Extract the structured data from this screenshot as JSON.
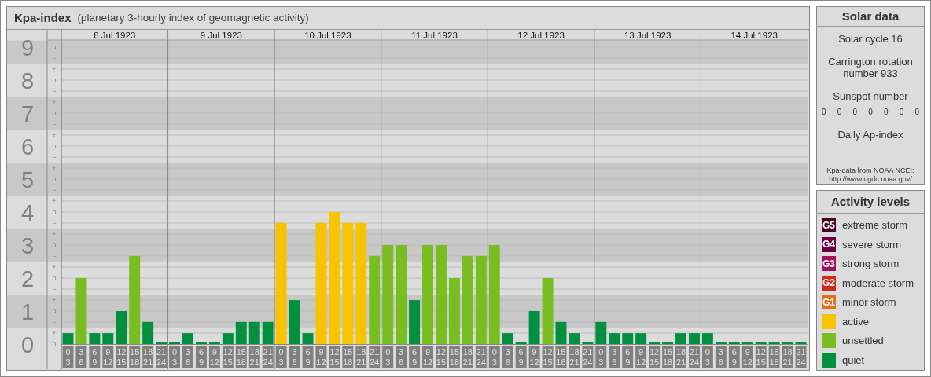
{
  "header": {
    "title": "Kpa-index",
    "subtitle": "(planetary 3-hourly index of geomagnetic activity)"
  },
  "chart": {
    "day_labels": [
      "8 Jul 1923",
      "9 Jul 1923",
      "10 Jul 1923",
      "11 Jul 1923",
      "12 Jul 1923",
      "13 Jul 1923",
      "14 Jul 1923"
    ],
    "sign_labels": [
      "o",
      "−",
      "+",
      "o",
      "−",
      "+",
      "o",
      "−",
      "+",
      "o",
      "−",
      "+",
      "o",
      "−",
      "+",
      "o",
      "−",
      "+",
      "o",
      "−",
      "+",
      "o",
      "−",
      "+",
      "o",
      "−",
      "+",
      "o"
    ],
    "chart_data": {
      "type": "bar",
      "grid": true,
      "ylim": [
        0,
        9
      ],
      "yticks": [
        0,
        1,
        2,
        3,
        4,
        5,
        6,
        7,
        8,
        9
      ],
      "bands": [
        {
          "axis": "y",
          "from": 0.5,
          "to": 1.5,
          "color": "#c8c8c8"
        },
        {
          "axis": "y",
          "from": 2.5,
          "to": 3.5,
          "color": "#c8c8c8"
        },
        {
          "axis": "y",
          "from": 4.5,
          "to": 5.5,
          "color": "#c8c8c8"
        },
        {
          "axis": "y",
          "from": 6.5,
          "to": 7.5,
          "color": "#c8c8c8"
        },
        {
          "axis": "y",
          "from": 8.5,
          "to": 9.2,
          "color": "#c8c8c8"
        }
      ],
      "categories": [
        "0 3",
        "3 6",
        "6 9",
        "9 12",
        "12 15",
        "15 18",
        "18 21",
        "21 24",
        "0 3",
        "3 6",
        "6 9",
        "9 12",
        "12 15",
        "15 18",
        "18 21",
        "21 24",
        "0 3",
        "3 6",
        "6 9",
        "9 12",
        "12 15",
        "15 18",
        "18 21",
        "21 24",
        "0 3",
        "3 6",
        "6 9",
        "9 12",
        "12 15",
        "15 18",
        "18 21",
        "21 24",
        "0 3",
        "3 6",
        "6 9",
        "9 12",
        "12 15",
        "15 18",
        "18 21",
        "21 24",
        "0 3",
        "3 6",
        "6 9",
        "9 12",
        "12 15",
        "15 18",
        "18 21",
        "21 24",
        "0 3",
        "3 6",
        "6 9",
        "9 12",
        "12 15",
        "15 18",
        "18 21",
        "21 24"
      ],
      "series": [
        {
          "name": "quiet",
          "color": "#009040",
          "values": [
            0.33,
            null,
            0.33,
            0.33,
            1,
            null,
            0.67,
            0,
            0,
            0.33,
            0,
            0,
            0.33,
            0.67,
            0.67,
            0.67,
            null,
            1.33,
            0.33,
            null,
            null,
            null,
            null,
            null,
            null,
            null,
            1.33,
            null,
            null,
            null,
            null,
            null,
            null,
            0.33,
            0,
            1,
            null,
            0.67,
            0.33,
            0,
            0.67,
            0.33,
            0.33,
            0.33,
            0,
            0,
            0.33,
            0.33,
            0.33,
            0,
            0,
            0,
            0,
            0,
            0,
            0
          ]
        },
        {
          "name": "unsettled",
          "color": "#78be20",
          "values": [
            null,
            2,
            null,
            null,
            null,
            2.67,
            null,
            null,
            null,
            null,
            null,
            null,
            null,
            null,
            null,
            null,
            null,
            null,
            null,
            null,
            null,
            null,
            null,
            2.67,
            3,
            3,
            null,
            3,
            3,
            2,
            2.67,
            2.67,
            3,
            null,
            null,
            null,
            2,
            null,
            null,
            null,
            null,
            null,
            null,
            null,
            null,
            null,
            null,
            null,
            null,
            null,
            null,
            null,
            null,
            null,
            null,
            null
          ]
        },
        {
          "name": "active",
          "color": "#f8c400",
          "values": [
            null,
            null,
            null,
            null,
            null,
            null,
            null,
            null,
            null,
            null,
            null,
            null,
            null,
            null,
            null,
            null,
            3.67,
            null,
            null,
            3.67,
            4,
            3.67,
            3.67,
            null,
            null,
            null,
            null,
            null,
            null,
            null,
            null,
            null,
            null,
            null,
            null,
            null,
            null,
            null,
            null,
            null,
            null,
            null,
            null,
            null,
            null,
            null,
            null,
            null,
            null,
            null,
            null,
            null,
            null,
            null,
            null,
            null
          ]
        }
      ]
    }
  },
  "solar_data": {
    "title": "Solar data",
    "solar_cycle": "Solar cycle 16",
    "carrington": "Carrington rotation number 933",
    "sunspot_label": "Sunspot number",
    "sunspots": [
      "0",
      "0",
      "0",
      "0",
      "0",
      "0",
      "0"
    ],
    "ap_label": "Daily Ap-index",
    "ap_values": [
      "—",
      "—",
      "—",
      "—",
      "—",
      "—",
      "—"
    ],
    "source": "Kpa-data from NOAA NCEI:",
    "source_url": "http://www.ngdc.noaa.gov/"
  },
  "activity_levels": {
    "title": "Activity levels",
    "items": [
      {
        "badge": "G5",
        "label": "extreme storm",
        "color": "#4a0020"
      },
      {
        "badge": "G4",
        "label": "severe storm",
        "color": "#6b0040"
      },
      {
        "badge": "G3",
        "label": "strong storm",
        "color": "#a5105e"
      },
      {
        "badge": "G2",
        "label": "moderate storm",
        "color": "#d42a1e"
      },
      {
        "badge": "G1",
        "label": "minor storm",
        "color": "#e0701c"
      }
    ]
  }
}
